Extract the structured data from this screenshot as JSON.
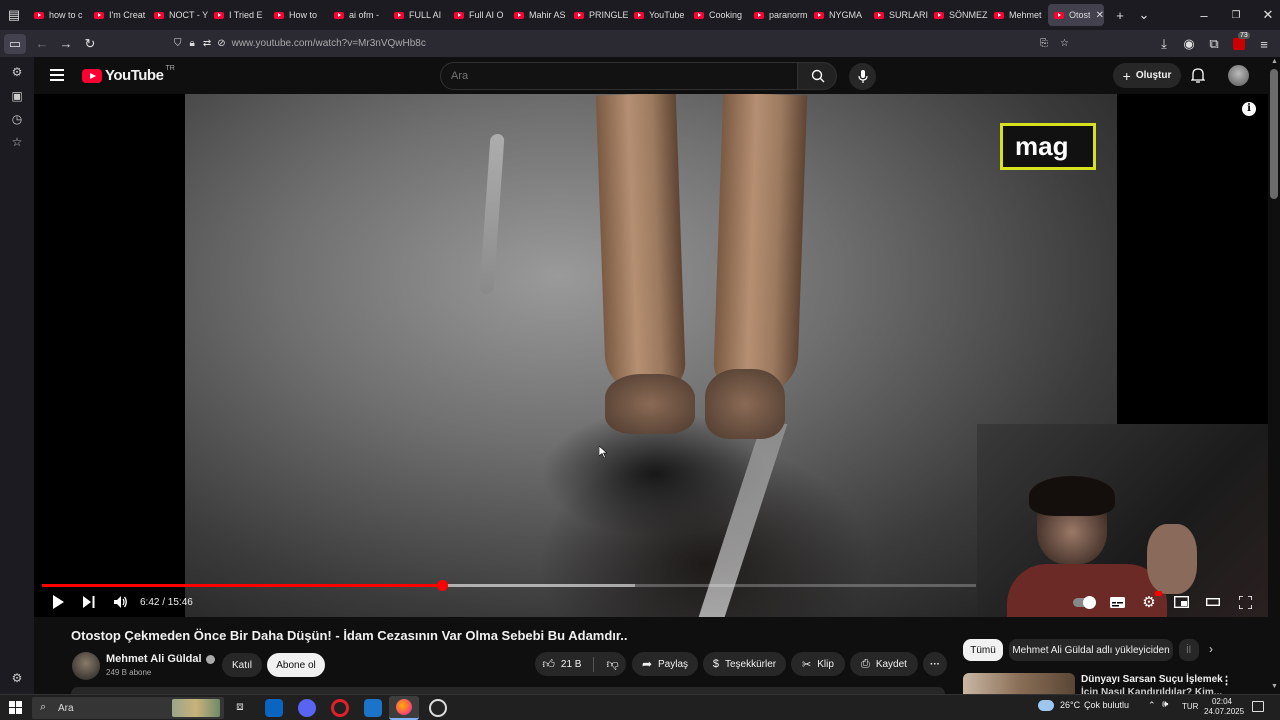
{
  "browser": {
    "tabs": [
      {
        "label": "how to c"
      },
      {
        "label": "I'm Creat"
      },
      {
        "label": "NOCT - Y"
      },
      {
        "label": "I Tried E"
      },
      {
        "label": "How to"
      },
      {
        "label": "ai ofm -"
      },
      {
        "label": "FULL AI"
      },
      {
        "label": "Full AI O"
      },
      {
        "label": "Mahir AS"
      },
      {
        "label": "PRINGLE"
      },
      {
        "label": "YouTube"
      },
      {
        "label": "Cooking"
      },
      {
        "label": "paranorm"
      },
      {
        "label": "NYGMA"
      },
      {
        "label": "SURLARI"
      },
      {
        "label": "SÖNMEZ"
      },
      {
        "label": "Mehmet"
      },
      {
        "label": "Otosto"
      }
    ],
    "url": "www.youtube.com/watch?v=Mr3nVQwHb8c",
    "extension_badge": "73"
  },
  "youtube": {
    "logo_text": "YouTube",
    "logo_region": "TR",
    "search_placeholder": "Ara",
    "create_label": "Oluştur"
  },
  "video": {
    "overlay_logo": "mag",
    "current_time": "6:42",
    "duration": "15:46",
    "time_display": "6:42 / 15:46",
    "progress_fraction": 0.428,
    "buffered_fraction": 0.635,
    "title": "Otostop Çekmeden Önce Bir Daha Düşün! - İdam Cezasının Var Olma Sebebi Bu Adamdır..",
    "channel_name": "Mehmet Ali Güldal",
    "subscribers": "249 B abone",
    "join_label": "Katıl",
    "subscribe_label": "Abone ol",
    "likes": "21 B",
    "share_label": "Paylaş",
    "thanks_label": "Teşekkürler",
    "clip_label": "Klip",
    "save_label": "Kaydet",
    "more_label": "···"
  },
  "recommendations": {
    "chips": [
      "Tümü",
      "Mehmet Ali Güldal adlı yükleyiciden",
      "İl"
    ],
    "first_title_line1": "Dünyayı Sarsan Suçu İşlemek",
    "first_title_line2": "İçin Nasıl Kandırıldılar? Kim..."
  },
  "taskbar": {
    "search_placeholder": "Ara",
    "temperature": "26°C",
    "weather": "Çok bulutlu",
    "language": "TUR",
    "time": "02:04",
    "date": "24.07.2025"
  },
  "colors": {
    "accent_red": "#ff0000",
    "youtube_red": "#ff0033",
    "mag_border": "#d7e21f",
    "background": "#0f0f0f"
  }
}
